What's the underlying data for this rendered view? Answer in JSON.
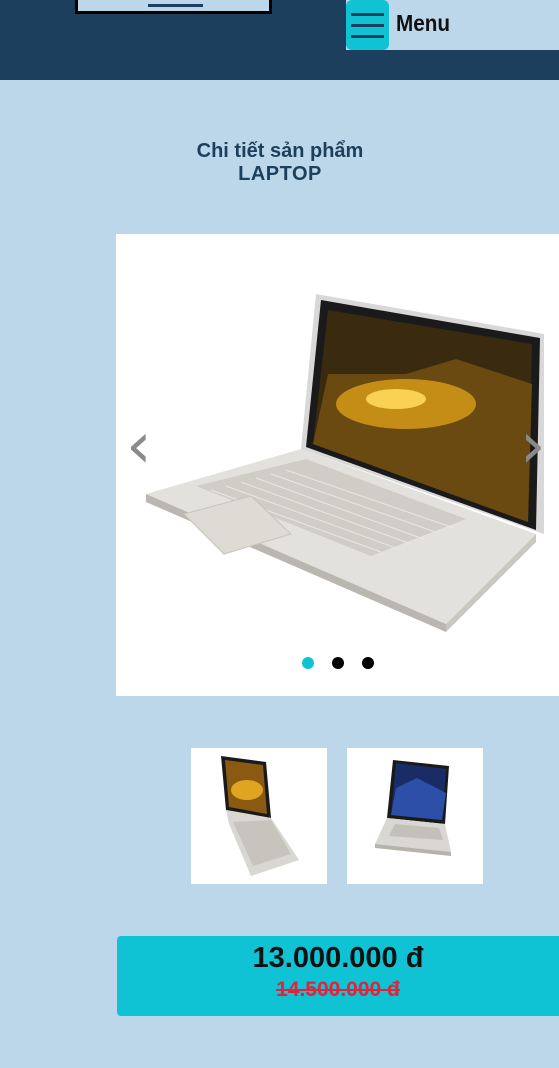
{
  "header": {
    "menu_label": "Menu"
  },
  "product": {
    "subtitle": "Chi tiết sản phẩm",
    "title": "LAPTOP"
  },
  "carousel": {
    "prev_icon": "chevron-left-icon",
    "next_icon": "chevron-right-icon",
    "prev_glyph": "‹",
    "next_glyph": "›",
    "active_index": 0,
    "slides": [
      "laptop-silver-angled",
      "laptop-side-view",
      "laptop-front-view"
    ]
  },
  "thumbnails": [
    "laptop-side-view",
    "laptop-front-view"
  ],
  "price": {
    "current": "13.000.000 đ",
    "old": "14.500.000 đ"
  },
  "colors": {
    "header_bg": "#1b3f5c",
    "page_bg": "#bdd7ea",
    "accent": "#0fc3d5",
    "old_price": "#e0243b"
  }
}
